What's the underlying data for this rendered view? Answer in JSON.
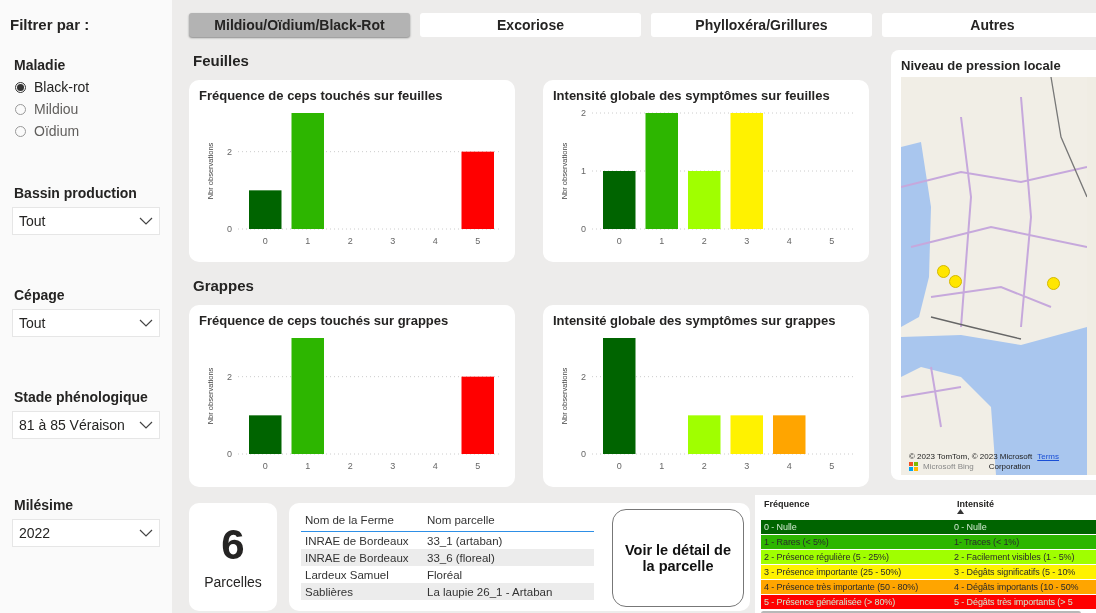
{
  "sidebar": {
    "title": "Filtrer par :",
    "filters": [
      {
        "kind": "radio",
        "label": "Maladie",
        "options": [
          {
            "label": "Black-rot",
            "selected": true
          },
          {
            "label": "Mildiou",
            "selected": false
          },
          {
            "label": "Oïdium",
            "selected": false
          }
        ]
      },
      {
        "kind": "dropdown",
        "label": "Bassin production",
        "value": "Tout"
      },
      {
        "kind": "dropdown",
        "label": "Cépage",
        "value": "Tout"
      },
      {
        "kind": "dropdown",
        "label": "Stade phénologique",
        "value": "81 à 85 Véraison"
      },
      {
        "kind": "dropdown",
        "label": "Milésime",
        "value": "2022"
      }
    ]
  },
  "tabs": [
    {
      "label": "Mildiou/Oïdium/Black-Rot",
      "selected": true
    },
    {
      "label": "Excoriose",
      "selected": false
    },
    {
      "label": "Phylloxéra/Grillures",
      "selected": false
    },
    {
      "label": "Autres",
      "selected": false
    }
  ],
  "sections": [
    {
      "title": "Feuilles",
      "charts": [
        {
          "chart_data": {
            "type": "bar",
            "title": "Fréquence de ceps touchés sur feuilles",
            "ylabel": "Nbr observations",
            "categories": [
              "0",
              "1",
              "2",
              "3",
              "4",
              "5"
            ],
            "series": [
              {
                "values": [
                  1,
                  3,
                  0,
                  0,
                  0,
                  2
                ]
              }
            ],
            "ylim": [
              0,
              3
            ],
            "yticks": [
              0,
              2
            ]
          }
        },
        {
          "chart_data": {
            "type": "bar",
            "title": "Intensité globale des symptômes sur feuilles",
            "ylabel": "Nbr observations",
            "categories": [
              "0",
              "1",
              "2",
              "3",
              "4",
              "5"
            ],
            "series": [
              {
                "values": [
                  1,
                  2,
                  1,
                  2,
                  0,
                  0
                ]
              }
            ],
            "ylim": [
              0,
              2
            ],
            "yticks": [
              0,
              1,
              2
            ]
          }
        }
      ]
    },
    {
      "title": "Grappes",
      "charts": [
        {
          "chart_data": {
            "type": "bar",
            "title": "Fréquence de ceps touchés sur grappes",
            "ylabel": "Nbr observations",
            "categories": [
              "0",
              "1",
              "2",
              "3",
              "4",
              "5"
            ],
            "series": [
              {
                "values": [
                  1,
                  3,
                  0,
                  0,
                  0,
                  2
                ]
              }
            ],
            "ylim": [
              0,
              3
            ],
            "yticks": [
              0,
              2
            ]
          }
        },
        {
          "chart_data": {
            "type": "bar",
            "title": "Intensité globale des symptômes sur grappes",
            "ylabel": "Nbr observations",
            "categories": [
              "0",
              "1",
              "2",
              "3",
              "4",
              "5"
            ],
            "series": [
              {
                "values": [
                  3,
                  0,
                  1,
                  1,
                  1,
                  0
                ]
              }
            ],
            "ylim": [
              0,
              3
            ],
            "yticks": [
              0,
              2
            ]
          }
        }
      ]
    }
  ],
  "map": {
    "title": "Niveau de pression locale",
    "attribution": "© 2023 TomTom, © 2023 Microsoft",
    "terms_link": "Terms",
    "attribution_2": "Corporation",
    "logo_text": "Microsoft Bing"
  },
  "summary": {
    "count": "6",
    "label": "Parcelles"
  },
  "parcels": {
    "columns": [
      "Nom de la Ferme",
      "Nom parcelle"
    ],
    "rows": [
      [
        "INRAE de Bordeaux",
        "33_1 (artaban)"
      ],
      [
        "INRAE de Bordeaux",
        "33_6 (floreal)"
      ],
      [
        "Lardeux Samuel",
        "Floréal"
      ],
      [
        "Sablières",
        "La laupie 26_1 - Artaban"
      ]
    ]
  },
  "detail_button": "Voir le détail de la parcelle",
  "legend": {
    "columns": [
      "Fréquence",
      "Intensité"
    ],
    "rows": [
      {
        "frequency": "0 - Nulle",
        "intensity": "0 - Nulle",
        "color": "#006400"
      },
      {
        "frequency": "1 - Rares (< 5%)",
        "intensity": "1- Traces (< 1%)",
        "color": "#2db600"
      },
      {
        "frequency": "2 - Présence régulière (5 - 25%)",
        "intensity": "2 - Facilement visibles (1 - 5%)",
        "color": "#a0ff00"
      },
      {
        "frequency": "3 - Présence importante (25 - 50%)",
        "intensity": "3 - Dégâts significatifs (5 - 10%",
        "color": "#fff200"
      },
      {
        "frequency": "4 - Présence très importante (50 - 80%)",
        "intensity": "4 - Dégâts importants (10 - 50%",
        "color": "#ffa500"
      },
      {
        "frequency": "5 - Présence généralisée (> 80%)",
        "intensity": "5 - Dégâts très importants (> 5",
        "color": "#ff0000"
      }
    ]
  }
}
